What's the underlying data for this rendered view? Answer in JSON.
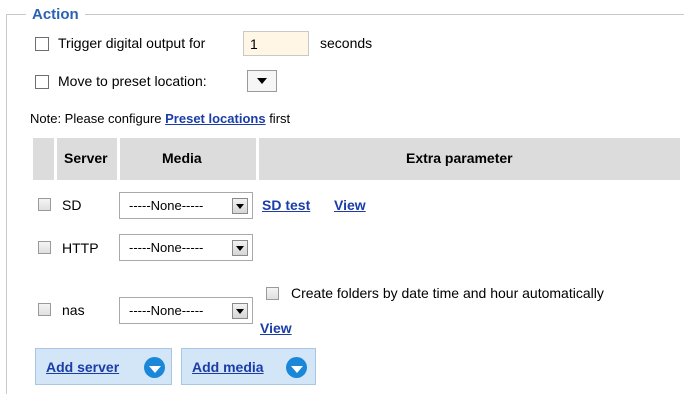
{
  "action": {
    "legend": "Action",
    "trigger": {
      "label": "Trigger digital output for",
      "value": "1",
      "unit": "seconds"
    },
    "preset": {
      "label": "Move to preset location:"
    },
    "note": {
      "prefix": "Note: Please configure ",
      "link": "Preset locations",
      "suffix": " first"
    }
  },
  "table": {
    "headers": [
      "Server",
      "Media",
      "Extra parameter"
    ],
    "rows": [
      {
        "server": "SD",
        "media": "-----None-----",
        "extra_link": "SD test",
        "view": "View"
      },
      {
        "server": "HTTP",
        "media": "-----None-----"
      },
      {
        "server": "nas",
        "media": "-----None-----",
        "extra_checkbox": "Create folders by date time and hour automatically",
        "view": "View"
      }
    ]
  },
  "buttons": {
    "add_server": "Add server",
    "add_media": "Add media"
  },
  "colors": {
    "legend": "#2a62b3",
    "link": "#1a3da8",
    "header_bg": "#dcdcdc",
    "button_bg": "#d3e6f7",
    "icon": "#1a87d9"
  }
}
